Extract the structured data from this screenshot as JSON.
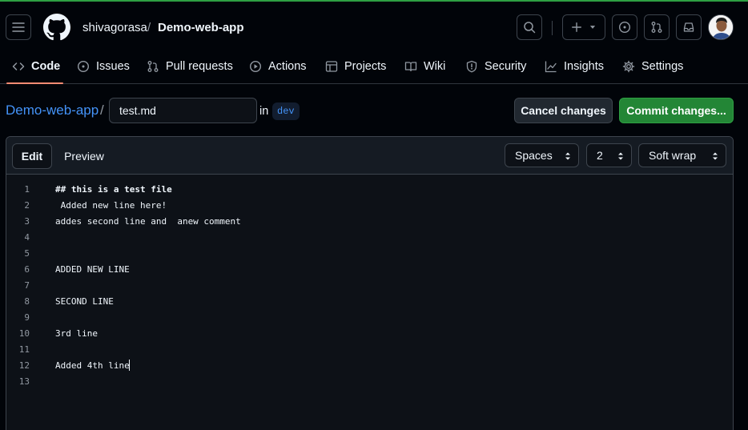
{
  "header": {
    "owner": "shivagorasa",
    "separator": "/",
    "repo": "Demo-web-app"
  },
  "nav": {
    "tabs": [
      {
        "label": "Code",
        "icon": "code-icon",
        "selected": true
      },
      {
        "label": "Issues",
        "icon": "issue-icon"
      },
      {
        "label": "Pull requests",
        "icon": "pull-request-icon"
      },
      {
        "label": "Actions",
        "icon": "play-icon"
      },
      {
        "label": "Projects",
        "icon": "table-icon"
      },
      {
        "label": "Wiki",
        "icon": "book-icon"
      },
      {
        "label": "Security",
        "icon": "shield-icon"
      },
      {
        "label": "Insights",
        "icon": "graph-icon"
      },
      {
        "label": "Settings",
        "icon": "gear-icon"
      }
    ]
  },
  "editbar": {
    "repo_link": "Demo-web-app",
    "slash": "/",
    "filename": "test.md",
    "in_label": "in",
    "branch": "dev",
    "cancel_label": "Cancel changes",
    "commit_label": "Commit changes..."
  },
  "editor": {
    "tab_edit": "Edit",
    "tab_preview": "Preview",
    "indent_mode": "Spaces",
    "indent_size": "2",
    "wrap_mode": "Soft wrap",
    "lines": [
      {
        "n": "1",
        "text": "## this is a test file"
      },
      {
        "n": "2",
        "text": " Added new line here!"
      },
      {
        "n": "3",
        "text": "addes second line and  anew comment"
      },
      {
        "n": "4",
        "text": ""
      },
      {
        "n": "5",
        "text": ""
      },
      {
        "n": "6",
        "text": "ADDED NEW LINE"
      },
      {
        "n": "7",
        "text": ""
      },
      {
        "n": "8",
        "text": "SECOND LINE"
      },
      {
        "n": "9",
        "text": ""
      },
      {
        "n": "10",
        "text": "3rd line"
      },
      {
        "n": "11",
        "text": ""
      },
      {
        "n": "12",
        "text": "Added 4th line"
      },
      {
        "n": "13",
        "text": ""
      }
    ]
  },
  "colors": {
    "background": "#010409",
    "accent_underline": "#fd8c73",
    "commit_green": "#238636",
    "link_blue": "#4493f8"
  }
}
